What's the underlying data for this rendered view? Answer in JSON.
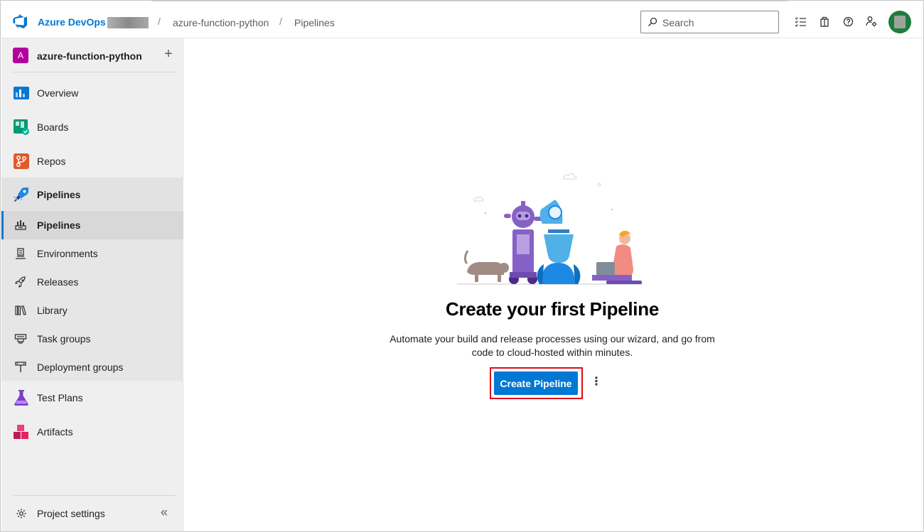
{
  "header": {
    "brand": "Azure DevOps",
    "breadcrumbs": [
      "azure-function-python",
      "Pipelines"
    ],
    "separator": "/",
    "search_placeholder": "Search",
    "icons": [
      "work-items-icon",
      "marketplace-bag-icon",
      "help-icon",
      "user-settings-icon"
    ]
  },
  "sidebar": {
    "project_initial": "A",
    "project_name": "azure-function-python",
    "add_symbol": "+",
    "items": [
      {
        "label": "Overview",
        "icon": "overview-icon"
      },
      {
        "label": "Boards",
        "icon": "boards-icon"
      },
      {
        "label": "Repos",
        "icon": "repos-icon"
      },
      {
        "label": "Pipelines",
        "icon": "pipelines-icon"
      },
      {
        "label": "Test Plans",
        "icon": "test-plans-icon"
      },
      {
        "label": "Artifacts",
        "icon": "artifacts-icon"
      }
    ],
    "pipeline_subitems": [
      {
        "label": "Pipelines",
        "icon": "pipelines-sub-icon"
      },
      {
        "label": "Environments",
        "icon": "environments-icon"
      },
      {
        "label": "Releases",
        "icon": "releases-icon"
      },
      {
        "label": "Library",
        "icon": "library-icon"
      },
      {
        "label": "Task groups",
        "icon": "task-groups-icon"
      },
      {
        "label": "Deployment groups",
        "icon": "deployment-groups-icon"
      }
    ],
    "settings_label": "Project settings",
    "collapse_symbol": "«"
  },
  "main": {
    "title": "Create your first Pipeline",
    "description": "Automate your build and release processes using our wizard, and go from code to cloud-hosted within minutes.",
    "create_button": "Create Pipeline",
    "more_symbol": "⋮"
  },
  "colors": {
    "accent": "#0078d4",
    "project_badge": "#b4009e",
    "highlight_border": "#e00b1c",
    "avatar": "#1e7d3c"
  }
}
